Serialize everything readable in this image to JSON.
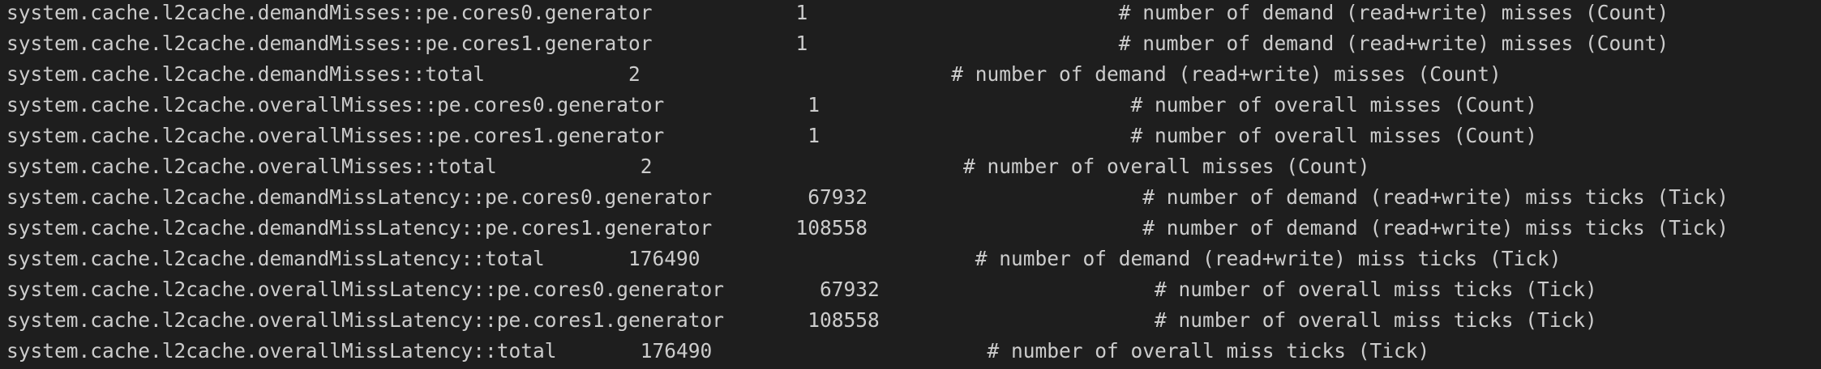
{
  "terminal": {
    "lines": [
      "system.cache.l2cache.demandMisses::pe.cores0.generator            1                          # number of demand (read+write) misses (Count)",
      "system.cache.l2cache.demandMisses::pe.cores1.generator            1                          # number of demand (read+write) misses (Count)",
      "system.cache.l2cache.demandMisses::total            2                          # number of demand (read+write) misses (Count)",
      "system.cache.l2cache.overallMisses::pe.cores0.generator            1                          # number of overall misses (Count)",
      "system.cache.l2cache.overallMisses::pe.cores1.generator            1                          # number of overall misses (Count)",
      "system.cache.l2cache.overallMisses::total            2                          # number of overall misses (Count)",
      "system.cache.l2cache.demandMissLatency::pe.cores0.generator        67932                       # number of demand (read+write) miss ticks (Tick)",
      "system.cache.l2cache.demandMissLatency::pe.cores1.generator       108558                       # number of demand (read+write) miss ticks (Tick)",
      "system.cache.l2cache.demandMissLatency::total       176490                       # number of demand (read+write) miss ticks (Tick)",
      "system.cache.l2cache.overallMissLatency::pe.cores0.generator        67932                       # number of overall miss ticks (Tick)",
      "system.cache.l2cache.overallMissLatency::pe.cores1.generator       108558                       # number of overall miss ticks (Tick)",
      "system.cache.l2cache.overallMissLatency::total       176490                       # number of overall miss ticks (Tick)"
    ]
  },
  "colors": {
    "background": "#1e1e1e",
    "text": "#cccccc"
  }
}
